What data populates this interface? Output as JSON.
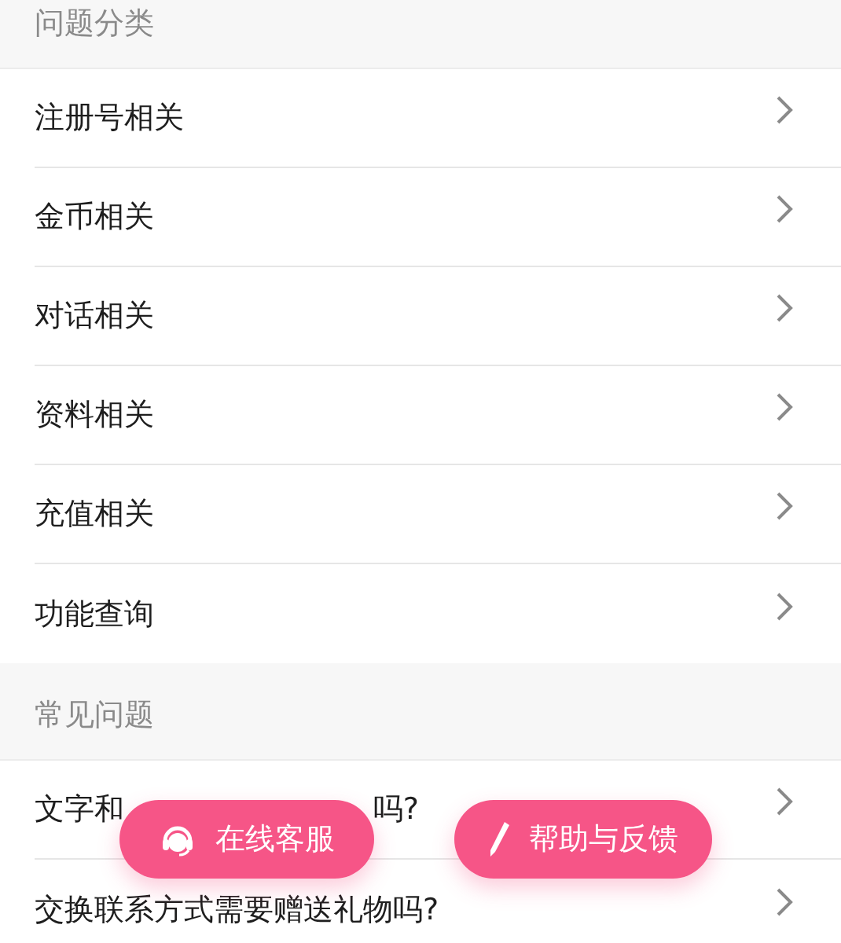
{
  "sections": [
    {
      "title": "问题分类",
      "items": [
        {
          "label": "注册号相关"
        },
        {
          "label": "金币相关"
        },
        {
          "label": "对话相关"
        },
        {
          "label": "资料相关"
        },
        {
          "label": "充值相关"
        },
        {
          "label": "功能查询"
        }
      ]
    },
    {
      "title": "常见问题",
      "items": [
        {
          "label": "文字和",
          "label_end": "吗?"
        },
        {
          "label": "交换联系方式需要赠送礼物吗?"
        }
      ]
    }
  ],
  "floating_buttons": [
    {
      "kind": "support",
      "label": "在线客服"
    },
    {
      "kind": "edit",
      "label": "帮助与反馈"
    }
  ]
}
